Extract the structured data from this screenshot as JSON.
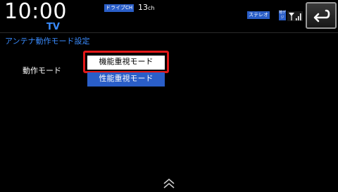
{
  "status_bar": {
    "clock": "10:00",
    "source": "TV",
    "drive_badge": "ドライブCH",
    "channel_number": "13",
    "channel_unit": "ch",
    "audio_badge": "ステレオ",
    "mini_badge_top": "地デ",
    "mini_badge_bottom": "ジ"
  },
  "screen": {
    "title": "アンテナ動作モード設定",
    "setting_label": "動作モード",
    "options": [
      {
        "label": "機能重視モード",
        "selected": true
      },
      {
        "label": "性能重視モード",
        "selected": false
      }
    ]
  },
  "icons": {
    "back": "return-arrow-icon",
    "signal": "antenna-signal-icon",
    "scroll": "double-chevron-up-icon"
  },
  "colors": {
    "accent_blue": "#3a8cff",
    "badge_blue": "#2a5ec8",
    "focus_red": "#e21818"
  }
}
